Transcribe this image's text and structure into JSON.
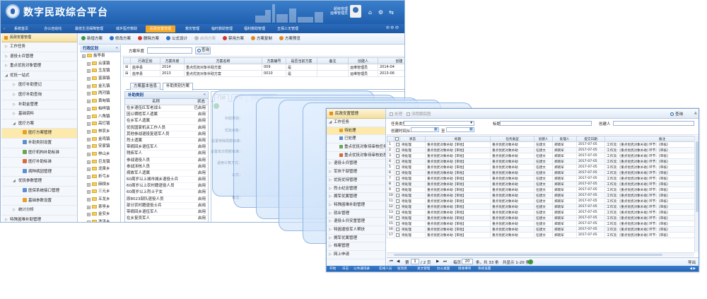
{
  "header": {
    "title": "数字民政综合平台",
    "user_name": "超级管理",
    "user_role": "运维管理员"
  },
  "nav": {
    "items": [
      "系统首页",
      "办公自动化",
      "最低生活保障管理",
      "城乡医疗救助",
      "民政安置管理",
      "救灾管理",
      "临时救助管理",
      "福利救助管理",
      "五保三无管理"
    ],
    "active_index": 4,
    "right_label": "中 中 中"
  },
  "left_nav": {
    "header": "民政安置管理",
    "items": [
      {
        "label": "工作任务",
        "level": 0,
        "arrow": "▷",
        "icon": ""
      },
      {
        "label": "退役士兵管理",
        "level": 0,
        "arrow": "▷",
        "icon": ""
      },
      {
        "label": "重点优抚对象管理",
        "level": 0,
        "arrow": "▷",
        "icon": ""
      },
      {
        "label": "优抚一站式",
        "level": 0,
        "arrow": "◢",
        "icon": ""
      },
      {
        "label": "医疗补助登记",
        "level": 1,
        "arrow": "▷",
        "icon": ""
      },
      {
        "label": "医疗补助查询",
        "level": 1,
        "arrow": "▷",
        "icon": ""
      },
      {
        "label": "补助金管理",
        "level": 1,
        "arrow": "▷",
        "icon": ""
      },
      {
        "label": "基础资料",
        "level": 1,
        "arrow": "▷",
        "icon": ""
      },
      {
        "label": "医疗方案",
        "level": 1,
        "arrow": "◢",
        "icon": ""
      },
      {
        "label": "医疗方案管理",
        "level": 2,
        "arrow": "",
        "icon": "#e5a02a",
        "selected": true
      },
      {
        "label": "补助类别设置",
        "level": 2,
        "arrow": "",
        "icon": "#5b8fd1"
      },
      {
        "label": "医疗机构补助标准",
        "level": 2,
        "arrow": "",
        "icon": "#6aa84f"
      },
      {
        "label": "医疗补助标准",
        "level": 2,
        "arrow": "",
        "icon": "#d86a3a"
      },
      {
        "label": "病种病因管理",
        "level": 2,
        "arrow": "",
        "icon": "#5b8fd1"
      },
      {
        "label": "优抚参数管理",
        "level": 1,
        "arrow": "◢",
        "icon": ""
      },
      {
        "label": "医保系统接口管理",
        "level": 2,
        "arrow": "",
        "icon": "#5b8fd1"
      },
      {
        "label": "基础参数设置",
        "level": 2,
        "arrow": "",
        "icon": "#e5a02a"
      },
      {
        "label": "统计分析",
        "level": 1,
        "arrow": "▷",
        "icon": ""
      },
      {
        "label": "特殊困难补助管理",
        "level": 0,
        "arrow": "▷",
        "icon": ""
      }
    ]
  },
  "toolbar": {
    "buttons": [
      {
        "label": "新增方案",
        "color": "#3a9a3a",
        "disabled": false
      },
      {
        "label": "修改方案",
        "color": "#2a6fc9",
        "disabled": false
      },
      {
        "label": "删除方案",
        "color": "#d9342b",
        "disabled": false
      },
      {
        "label": "公式设计",
        "color": "#2a6fc9",
        "disabled": false
      },
      {
        "label": "启用方案",
        "color": "#bbbbbb",
        "disabled": true
      },
      {
        "label": "禁用方案",
        "color": "#d9342b",
        "disabled": false
      },
      {
        "label": "方案复制",
        "color": "#e08a1e",
        "disabled": false
      },
      {
        "label": "方案预览",
        "color": "#e08a1e",
        "disabled": false
      }
    ]
  },
  "tree": {
    "title": "行政区划",
    "rows": [
      "盐亭县",
      "云溪镇",
      "玉龙镇",
      "富驿镇",
      "金孔镇",
      "两河镇",
      "黄甸镇",
      "柏梓镇",
      "八角镇",
      "高灯镇",
      "林农乡",
      "金鸡镇",
      "安家镇",
      "林山乡",
      "巨龙镇",
      "龙泉乡",
      "折弓乡",
      "麻秧乡",
      "三元乡",
      "五龙乡",
      "茶亭乡",
      "金安乡",
      "洗泽乡",
      "毛公乡"
    ]
  },
  "search": {
    "label": "方案年度",
    "button": "查询"
  },
  "scheme_table": {
    "headers": [
      "",
      "行政区划",
      "方案年度",
      "方案名称",
      "方案编号",
      "是否当前方案",
      "备注",
      "创建人",
      "创建"
    ],
    "rows": [
      [
        "⊞",
        "盐亭县",
        "2014",
        "重点优抚对象补助方案",
        "009",
        "是",
        "",
        "运维管理员",
        "2014-04"
      ],
      [
        "⊞",
        "盐亭县",
        "2013",
        "重点优抚对象补助方案",
        "0010",
        "是",
        "",
        "运维管理员",
        "2013-06"
      ]
    ]
  },
  "lower_tabs": [
    "方案基本信息",
    "补助类别方案"
  ],
  "category_panel": {
    "title": "补助类别",
    "headers": [
      "名称",
      "状态"
    ],
    "rows": [
      [
        "在乡退伍红军老战士",
        "已启用"
      ],
      [
        "因公牺牲军人遗属",
        "启用"
      ],
      [
        "在乡军人遗属",
        "启用"
      ],
      [
        "优抚国家机关工作人员",
        "启用"
      ],
      [
        "其他参战退役复退军人员",
        "启用"
      ],
      [
        "烈士遗属",
        "启用"
      ],
      [
        "带病回乡退伍军人",
        "启用"
      ],
      [
        "残疾军人",
        "启用"
      ],
      [
        "参战退役人员",
        "启用"
      ],
      [
        "参战涉核人员",
        "启用"
      ],
      [
        "病故军人遗属",
        "启用"
      ],
      [
        "60周岁以上城市城乡退役士兵",
        "启用"
      ],
      [
        "60周岁以上农村籍退役人员",
        "启用"
      ],
      [
        "60周岁以上烈士子女",
        "启用"
      ],
      [
        "原8023部队退役人员",
        "启用"
      ],
      [
        "部分农村籍退役士兵",
        "启用"
      ],
      [
        "带病回乡退伍军人",
        "启用"
      ],
      [
        "在乡复员军人",
        "启用"
      ],
      [
        "其他",
        "启用"
      ]
    ]
  },
  "right_tabs": [
    "门诊",
    "住院",
    "住院大病救助"
  ],
  "ghost_texts": [
    "补助类别：",
    "优抚对象：",
    "设置特殊限额标准：",
    "设置单次限额标准：",
    "适用计算方式：",
    "公式：",
    "备注："
  ],
  "front_window": {
    "left_header": "民政安置管理",
    "left_items": [
      {
        "label": "工作任务",
        "sub": false,
        "arrow": "◢",
        "icon": ""
      },
      {
        "label": "待处理",
        "sub": true,
        "arrow": "",
        "icon": "#e5a02a",
        "selected": true
      },
      {
        "label": "已处理",
        "sub": true,
        "arrow": "",
        "icon": "#5b8fd1"
      },
      {
        "label": "重点优抚对象待审核任务",
        "sub": true,
        "arrow": "",
        "icon": "#6aa84f"
      },
      {
        "label": "重点优抚对象待审核处理",
        "sub": true,
        "arrow": "",
        "icon": "#d86a3a"
      },
      {
        "label": "退役士兵管理",
        "sub": false,
        "arrow": "▷",
        "icon": ""
      },
      {
        "label": "军休干部管理",
        "sub": false,
        "arrow": "▷",
        "icon": ""
      },
      {
        "label": "优抚优待管理",
        "sub": false,
        "arrow": "▷",
        "icon": ""
      },
      {
        "label": "烈士纪念管理",
        "sub": false,
        "arrow": "▷",
        "icon": ""
      },
      {
        "label": "拥军优属管理",
        "sub": false,
        "arrow": "▷",
        "icon": ""
      },
      {
        "label": "特殊困难补助管理",
        "sub": false,
        "arrow": "▷",
        "icon": ""
      },
      {
        "label": "就业管理",
        "sub": false,
        "arrow": "▷",
        "icon": ""
      },
      {
        "label": "退役士兵安置管理",
        "sub": false,
        "arrow": "▷",
        "icon": ""
      },
      {
        "label": "特困退役军人帮扶",
        "sub": false,
        "arrow": "▷",
        "icon": ""
      },
      {
        "label": "拥军优属管理",
        "sub": false,
        "arrow": "▷",
        "icon": ""
      },
      {
        "label": "档案管理",
        "sub": false,
        "arrow": "▷",
        "icon": ""
      },
      {
        "label": "网上申请",
        "sub": false,
        "arrow": "▷",
        "icon": ""
      }
    ],
    "toolbar": [
      "处理",
      "流程跟踪图"
    ],
    "toolbar_right": "查询",
    "search": {
      "task_type_label": "任务类型",
      "title_label": "标题",
      "creator_label": "创建人",
      "created_label": "创建时间从",
      "to_label": "至"
    },
    "grid_headers": [
      "",
      "",
      "状态",
      "标题",
      "任务类型",
      "创建人",
      "处理人",
      "提交日期",
      "备注"
    ],
    "grid_rows": [
      [
        "1",
        "",
        "待处理",
        "重点优抚对象补助【审批】",
        "重点优抚对象补助",
        "任建文",
        "郑晓军",
        "2017-07-05",
        "工作流：[重点优抚对象补助] 环节：[审核]"
      ],
      [
        "2",
        "",
        "待处理",
        "重点优抚对象补助【审批】",
        "重点优抚对象补助",
        "任建文",
        "郑晓军",
        "2017-07-05",
        "工作流：[重点优抚对象补助] 环节：[审核]"
      ],
      [
        "3",
        "",
        "待处理",
        "重点优抚对象补助【审批】",
        "重点优抚对象补助",
        "任建文",
        "郑晓军",
        "2017-07-05",
        "工作流：[重点优抚对象补助] 环节：[审核]"
      ],
      [
        "4",
        "",
        "待处理",
        "重点优抚对象补助【审批】",
        "重点优抚对象补助",
        "任建文",
        "郑晓军",
        "2017-07-05",
        "工作流：[重点优抚对象补助] 环节：[审核]"
      ],
      [
        "5",
        "",
        "待处理",
        "重点优抚对象补助【审批】",
        "重点优抚对象补助",
        "任建文",
        "郑晓军",
        "2017-07-05",
        "工作流：[重点优抚对象补助] 环节：[审核]"
      ],
      [
        "6",
        "",
        "待处理",
        "重点优抚对象补助【审批】",
        "重点优抚对象补助",
        "任建文",
        "郑晓军",
        "2017-07-05",
        "工作流：[重点优抚对象补助] 环节：[审核]"
      ],
      [
        "7",
        "",
        "待处理",
        "重点优抚对象补助【审批】",
        "重点优抚对象补助",
        "任建文",
        "郑晓军",
        "2017-07-05",
        "工作流：[重点优抚对象补助] 环节：[审核]"
      ],
      [
        "8",
        "",
        "待处理",
        "重点优抚对象补助【审批】",
        "重点优抚对象补助",
        "任建文",
        "郑晓军",
        "2017-07-05",
        "工作流：[重点优抚对象补助] 环节：[审核]"
      ],
      [
        "9",
        "",
        "待处理",
        "重点优抚对象补助【审批】",
        "重点优抚对象补助",
        "任建文",
        "郑晓军",
        "2017-07-05",
        "工作流：[重点优抚对象补助] 环节：[审核]"
      ],
      [
        "10",
        "",
        "待处理",
        "重点优抚对象补助【审批】",
        "重点优抚对象补助",
        "任建文",
        "郑晓军",
        "2017-07-05",
        "工作流：[重点优抚对象补助] 环节：[审核]"
      ],
      [
        "11",
        "",
        "待处理",
        "重点优抚对象补助【审批】",
        "重点优抚对象补助",
        "任建文",
        "郑晓军",
        "2017-07-05",
        "工作流：[重点优抚对象补助] 环节：[审核]"
      ],
      [
        "12",
        "",
        "待处理",
        "重点优抚对象补助【审批】",
        "重点优抚对象补助",
        "任建文",
        "郑晓军",
        "2017-07-05",
        "工作流：[重点优抚对象补助] 环节：[审核]"
      ],
      [
        "13",
        "",
        "待处理",
        "重点优抚对象补助【审批】",
        "重点优抚对象补助",
        "任建文",
        "郑晓军",
        "2017-07-05",
        "工作流：[重点优抚对象补助] 环节：[审核]"
      ],
      [
        "14",
        "",
        "待处理",
        "重点优抚对象补助【审批】",
        "重点优抚对象补助",
        "任建文",
        "郑晓军",
        "2017-07-05",
        "工作流：[重点优抚对象补助] 环节：[审核]"
      ],
      [
        "15",
        "",
        "待处理",
        "重点优抚对象补助【审批】",
        "重点优抚对象补助",
        "任建文",
        "郑晓军",
        "2017-07-05",
        "工作流：[重点优抚对象补助] 环节：[审核]"
      ],
      [
        "16",
        "",
        "待处理",
        "重点优抚对象补助【审批】",
        "重点优抚对象补助",
        "任建文",
        "郑晓军",
        "2017-07-05",
        "工作流：[重点优抚对象补助] 环节：[审核]"
      ],
      [
        "17",
        "",
        "待处理",
        "重点优抚对象补助【审批】",
        "重点优抚对象补助",
        "任建文",
        "郑晓军",
        "2017-07-05",
        "工作流：[重点优抚对象补助] 环节：[审核]"
      ]
    ],
    "pager": {
      "first": "⏮",
      "prev": "◀",
      "page_label": "第",
      "page_value": "1",
      "page_total": "/ 2 页",
      "next": "▶",
      "last": "⏭",
      "per_page_label": "每页",
      "per_page_value": "20",
      "info": "条，共 33 条",
      "display": "共显示 1-20 条",
      "export": "导出"
    },
    "taskbar": [
      "开始",
      "日志",
      "公共通讯录",
      "在线人员",
      "短消息",
      "发文管理",
      "办公桌面",
      "接收事项",
      "系统设置"
    ]
  }
}
